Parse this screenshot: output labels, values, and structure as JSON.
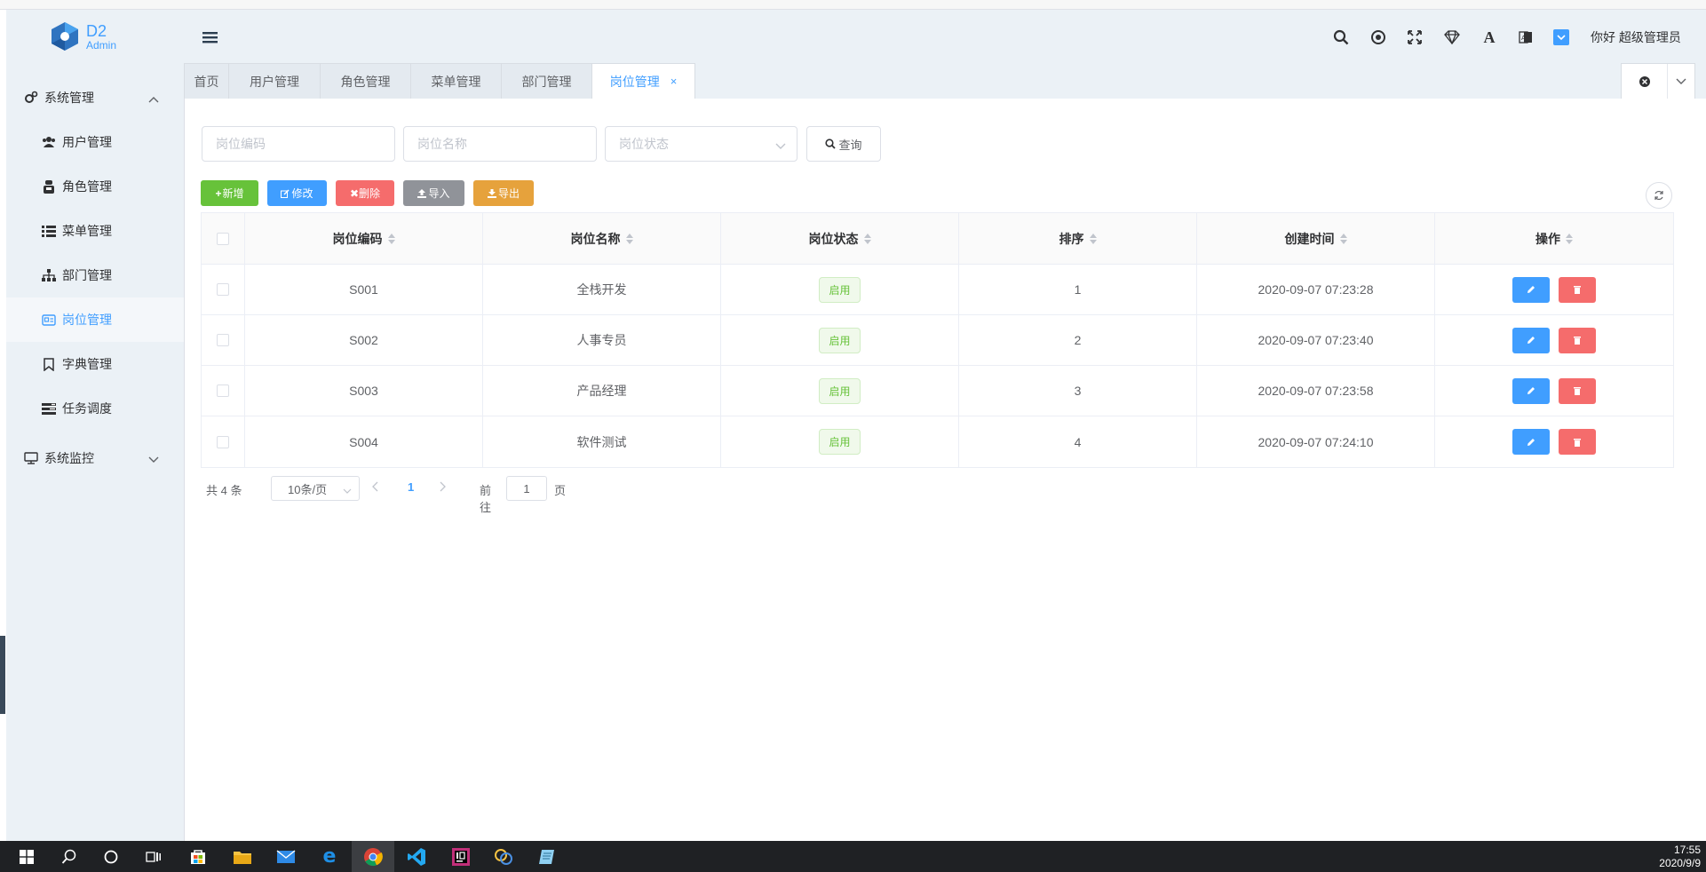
{
  "app": {
    "logo_main": "D2",
    "logo_sub": "Admin",
    "greeting": "你好 超级管理员"
  },
  "sidebar": {
    "group_system": "系统管理",
    "items": [
      {
        "label": "用户管理",
        "icon": "users-icon"
      },
      {
        "label": "角色管理",
        "icon": "user-secret-icon"
      },
      {
        "label": "菜单管理",
        "icon": "list-icon"
      },
      {
        "label": "部门管理",
        "icon": "sitemap-icon"
      },
      {
        "label": "岗位管理",
        "icon": "id-card-icon",
        "active": true
      },
      {
        "label": "字典管理",
        "icon": "bookmark-icon"
      },
      {
        "label": "任务调度",
        "icon": "tasks-icon"
      }
    ],
    "group_monitor": "系统监控"
  },
  "tabs": [
    {
      "label": "首页"
    },
    {
      "label": "用户管理"
    },
    {
      "label": "角色管理"
    },
    {
      "label": "菜单管理"
    },
    {
      "label": "部门管理"
    },
    {
      "label": "岗位管理",
      "active": true,
      "close": "×"
    }
  ],
  "search": {
    "code_placeholder": "岗位编码",
    "name_placeholder": "岗位名称",
    "status_placeholder": "岗位状态",
    "query_label": "查询"
  },
  "toolbar": {
    "add": "新增",
    "edit": "修改",
    "delete": "删除",
    "import": "导入",
    "export": "导出"
  },
  "table": {
    "headers": [
      "岗位编码",
      "岗位名称",
      "岗位状态",
      "排序",
      "创建时间",
      "操作"
    ],
    "rows": [
      {
        "code": "S001",
        "name": "全栈开发",
        "status": "启用",
        "sort": "1",
        "created": "2020-09-07 07:23:28"
      },
      {
        "code": "S002",
        "name": "人事专员",
        "status": "启用",
        "sort": "2",
        "created": "2020-09-07 07:23:40"
      },
      {
        "code": "S003",
        "name": "产品经理",
        "status": "启用",
        "sort": "3",
        "created": "2020-09-07 07:23:58"
      },
      {
        "code": "S004",
        "name": "软件测试",
        "status": "启用",
        "sort": "4",
        "created": "2020-09-07 07:24:10"
      }
    ]
  },
  "pagination": {
    "total": "共 4 条",
    "page_size": "10条/页",
    "current": "1",
    "goto_label": "前往",
    "goto_value": "1",
    "page_suffix": "页"
  },
  "taskbar": {
    "time": "17:55",
    "date": "2020/9/9"
  },
  "colors": {
    "primary": "#409eff",
    "success": "#67c23a",
    "danger": "#f56c6c",
    "info": "#909399",
    "warning": "#e6a23c"
  }
}
